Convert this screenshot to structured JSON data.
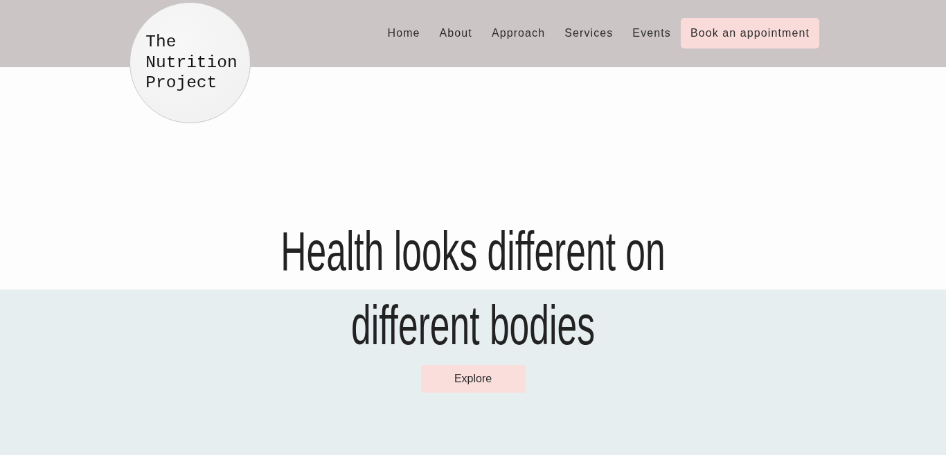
{
  "logo": {
    "text": "The Nutrition Project"
  },
  "nav": {
    "links": [
      "Home",
      "About",
      "Approach",
      "Services",
      "Events"
    ],
    "cta": "Book an appointment"
  },
  "hero": {
    "heading": "Health looks different on different bodies",
    "button": "Explore"
  }
}
